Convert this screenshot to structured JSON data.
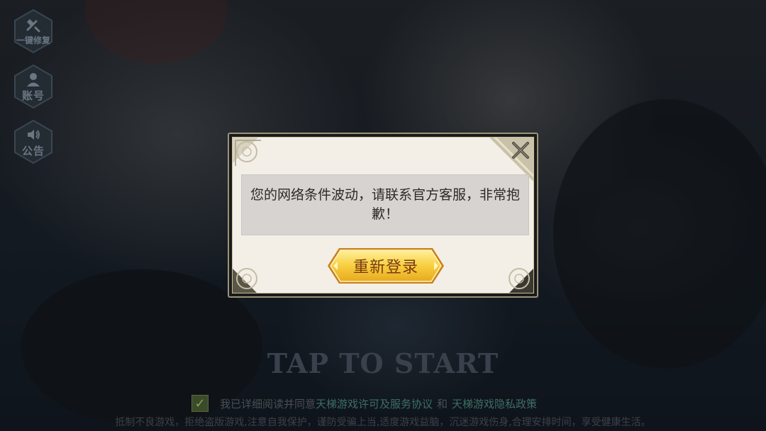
{
  "side_buttons": [
    {
      "id": "repair",
      "label": "一键修复",
      "icon": "hammer-wrench-icon"
    },
    {
      "id": "account",
      "label": "账号",
      "icon": "person-icon"
    },
    {
      "id": "notice",
      "label": "公告",
      "icon": "speaker-icon"
    }
  ],
  "start_prompt": "TAP TO START",
  "agreement": {
    "checked": true,
    "prefix": "我已详细阅读并同意",
    "license_link": "天梯游戏许可及服务协议",
    "conjunction": "和",
    "privacy_link": "天梯游戏隐私政策"
  },
  "health_notice": "抵制不良游戏，拒绝盗版游戏,注意自我保护，谨防受骗上当,适度游戏益脑，沉迷游戏伤身,合理安排时间，享受健康生活。",
  "dialog": {
    "message": "您的网络条件波动，请联系官方客服，非常抱歉！",
    "relogin_label": "重新登录",
    "close_icon": "close-x-icon"
  },
  "colors": {
    "dialog_bg": "#f3efe7",
    "message_bg": "#d6d3d0",
    "button_gold": "#f5c93a",
    "button_text": "#7a3a14",
    "link_green": "#3e6e66"
  }
}
